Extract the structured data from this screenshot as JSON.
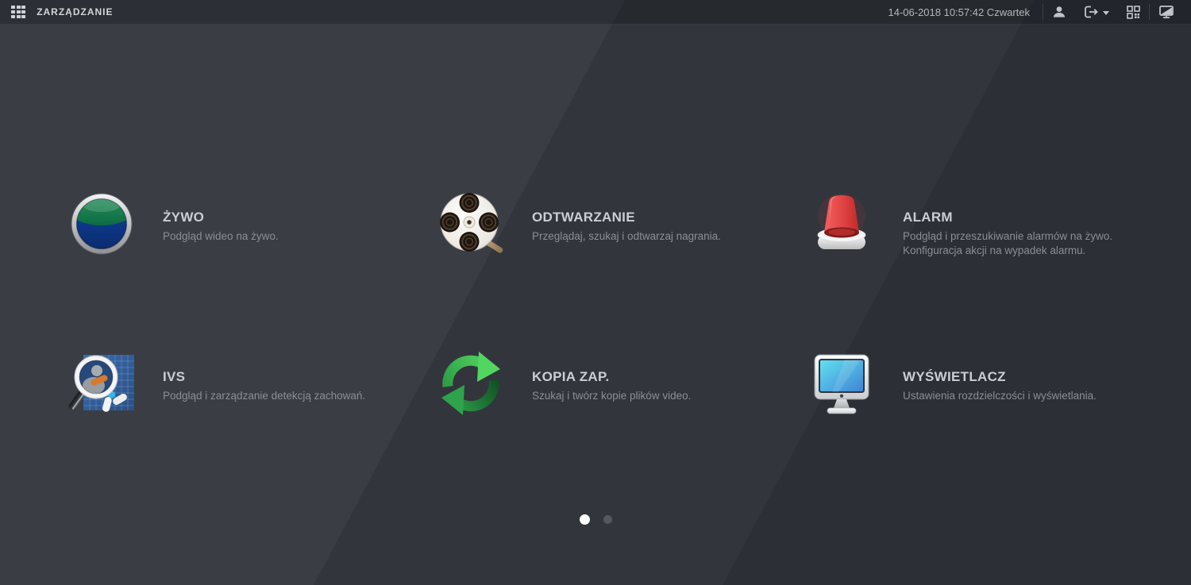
{
  "topbar": {
    "title": "ZARZĄDZANIE",
    "datetime": "14-06-2018 10:57:42 Czwartek",
    "icons": {
      "left": "apps-grid-icon",
      "right": [
        "user-icon",
        "logout-icon",
        "qr-code-icon",
        "display-toggle-icon"
      ]
    }
  },
  "menu": {
    "items": [
      {
        "id": "zywo",
        "title": "ŻYWO",
        "desc1": "Podgląd wideo na żywo.",
        "desc2": "",
        "icon": "live-view-icon"
      },
      {
        "id": "odtwarzanie",
        "title": "ODTWARZANIE",
        "desc1": "Przeglądaj, szukaj i odtwarzaj nagrania.",
        "desc2": "",
        "icon": "playback-icon"
      },
      {
        "id": "alarm",
        "title": "ALARM",
        "desc1": "Podgląd i przeszukiwanie alarmów na żywo.",
        "desc2": "Konfiguracja akcji na wypadek alarmu.",
        "icon": "alarm-siren-icon"
      },
      {
        "id": "ivs",
        "title": "IVS",
        "desc1": "Podgląd i zarządzanie detekcją zachowań.",
        "desc2": "",
        "icon": "ivs-magnifier-icon"
      },
      {
        "id": "kopia-zap",
        "title": "KOPIA ZAP.",
        "desc1": "Szukaj i twórz kopie plików video.",
        "desc2": "",
        "icon": "backup-sync-icon"
      },
      {
        "id": "wyswietlacz",
        "title": "WYŚWIETLACZ",
        "desc1": "Ustawienia rozdzielczości i wyświetlania.",
        "desc2": "",
        "icon": "display-monitor-icon"
      }
    ]
  },
  "pagination": {
    "current_page": 1,
    "total_pages": 2
  },
  "colors": {
    "bg_light": "#3a3d44",
    "bg_mid": "#32353c",
    "bg_dark": "#2c2f36",
    "topbar_text": "#d3d5d8",
    "datetime_text": "#b4b7bc",
    "item_title": "#ccced3",
    "item_desc": "#8b8e94",
    "accent_green": "#3fae49",
    "accent_red": "#d93b3b",
    "accent_cyan": "#2fb7e8",
    "dot_active": "#ffffff",
    "dot_inactive": "#55585e"
  }
}
